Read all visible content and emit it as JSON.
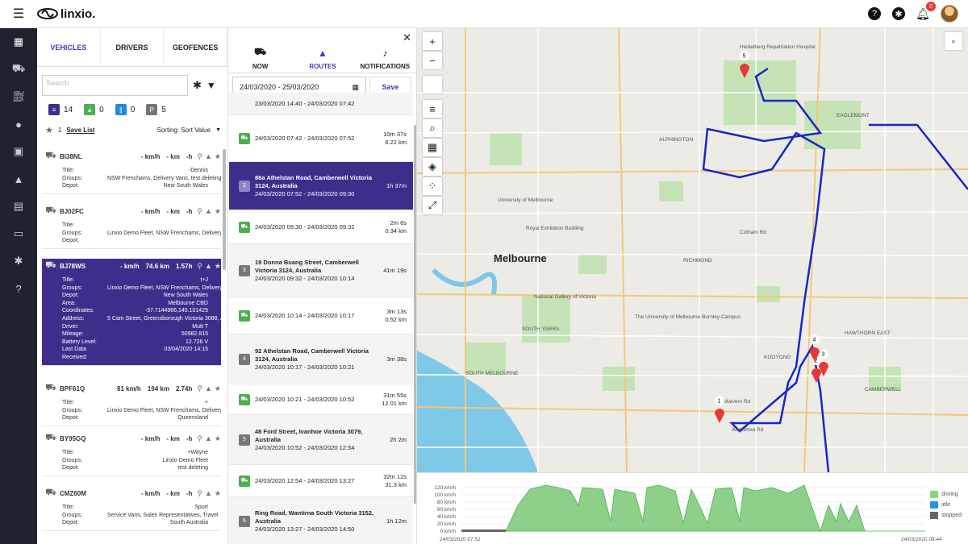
{
  "app": {
    "name": "linxio."
  },
  "topbar": {
    "icons": [
      "help-icon",
      "gear-icon",
      "bell-icon"
    ],
    "notification_count": "0"
  },
  "left_nav": [
    "map-icon",
    "vehicle-icon",
    "fuel-icon",
    "user-icon",
    "image-icon",
    "alert-icon",
    "document-icon",
    "device-icon",
    "settings-icon",
    "help-icon"
  ],
  "panel1": {
    "tabs": [
      "VEHICLES",
      "DRIVERS",
      "GEOFENCES"
    ],
    "search_placeholder": "Search",
    "stats": [
      {
        "label": "14",
        "color": "#3f2d8c",
        "icon": "list-icon"
      },
      {
        "label": "0",
        "color": "#4caf50",
        "icon": "up-icon"
      },
      {
        "label": "0",
        "color": "#1e88e5",
        "icon": "pause-icon"
      },
      {
        "label": "5",
        "color": "#757575",
        "icon": "parked-icon"
      }
    ],
    "saved_count": "1",
    "save_list": "Save List",
    "sorting": "Sorting: Sort Value",
    "vehicles": [
      {
        "reg": "BI38NL",
        "speed": "- km/h",
        "dist": "- km",
        "time": "-h",
        "rows": [
          [
            "Title:",
            "-Dennis"
          ],
          [
            "Groups:",
            "NSW Frenchams, Delivery Vans, test deleting"
          ],
          [
            "Depot:",
            "New South Wales"
          ]
        ]
      },
      {
        "reg": "BJ02FC",
        "speed": "- km/h",
        "dist": "- km",
        "time": "-h",
        "rows": [
          [
            "Title:",
            ""
          ],
          [
            "Groups:",
            "Linxio Demo Fleet, NSW Frenchams, Delivery Vans"
          ],
          [
            "Depot:",
            ""
          ]
        ]
      },
      {
        "reg": "BJ78WS",
        "speed": "- km/h",
        "dist": "74.6 km",
        "time": "1.57h",
        "rows": [
          [
            "Title:",
            "t+J"
          ],
          [
            "Groups:",
            "Linxio Demo Fleet, NSW Frenchams, Delivery Vans"
          ],
          [
            "Depot:",
            "New South Wales"
          ],
          [
            "Area:",
            "Melbourne CBD"
          ],
          [
            "Coordinates:",
            "-37.7144966,145.101425"
          ],
          [
            "Address:",
            "5 Cam Street, Greensborough Victoria 3088, Australia"
          ],
          [
            "Driver:",
            "Mutt T"
          ],
          [
            "Mileage:",
            "50982.815"
          ],
          [
            "Battery Level:",
            "12.726 V"
          ],
          [
            "Last Data Received:",
            "03/04/2020 14:15"
          ]
        ]
      },
      {
        "reg": "BPF61Q",
        "speed": "81 km/h",
        "dist": "194 km",
        "time": "2.74h",
        "rows": [
          [
            "Title:",
            "+"
          ],
          [
            "Groups:",
            "Linxio Demo Fleet, NSW Frenchams, Delivery Vans"
          ],
          [
            "Depot:",
            "Queensland"
          ]
        ]
      },
      {
        "reg": "BY95GQ",
        "speed": "- km/h",
        "dist": "- km",
        "time": "-h",
        "rows": [
          [
            "Title:",
            "+Wayne"
          ],
          [
            "Groups:",
            "Linxio Demo Fleet"
          ],
          [
            "Depot:",
            "test deleting"
          ]
        ]
      },
      {
        "reg": "CMZ60M",
        "speed": "- km/h",
        "dist": "- km",
        "time": "-h",
        "rows": [
          [
            "Title:",
            "Sport"
          ],
          [
            "Groups:",
            "Service Vans, Sales Representatives, Travel"
          ],
          [
            "Depot:",
            "South Australia"
          ]
        ]
      }
    ]
  },
  "panel2": {
    "tabs": [
      {
        "label": "NOW",
        "icon": "car-icon"
      },
      {
        "label": "ROUTES",
        "icon": "navigation-icon"
      },
      {
        "label": "NOTIFICATIONS",
        "icon": "bell-icon"
      }
    ],
    "date_range": "24/03/2020 - 25/03/2020",
    "save": "Save",
    "routes": [
      {
        "kind": "stop",
        "num": "",
        "addr": "",
        "time": "23/03/2020 14:40 - 24/03/2020 07:42",
        "dur": "",
        "dist": ""
      },
      {
        "kind": "drive",
        "num": "",
        "addr": "",
        "time": "24/03/2020 07:42 - 24/03/2020 07:52",
        "dur": "10m 37s",
        "dist": "6.22 km"
      },
      {
        "kind": "stop",
        "num": "2",
        "addr": "86a Athelstan Road, Camberwell Victoria 3124, Australia",
        "time": "24/03/2020 07:52 - 24/03/2020 09:30",
        "dur": "1h 37m",
        "dist": ""
      },
      {
        "kind": "drive",
        "num": "",
        "addr": "",
        "time": "24/03/2020 09:30 - 24/03/2020 09:32",
        "dur": "2m 6s",
        "dist": "0.34 km"
      },
      {
        "kind": "stop",
        "num": "3",
        "addr": "19 Donna Buang Street, Camberwell Victoria 3124, Australia",
        "time": "24/03/2020 09:32 - 24/03/2020 10:14",
        "dur": "41m 19s",
        "dist": ""
      },
      {
        "kind": "drive",
        "num": "",
        "addr": "",
        "time": "24/03/2020 10:14 - 24/03/2020 10:17",
        "dur": "3m 13s",
        "dist": "0.52 km"
      },
      {
        "kind": "stop",
        "num": "4",
        "addr": "92 Athelstan Road, Camberwell Victoria 3124, Australia",
        "time": "24/03/2020 10:17 - 24/03/2020 10:21",
        "dur": "3m 38s",
        "dist": ""
      },
      {
        "kind": "drive",
        "num": "",
        "addr": "",
        "time": "24/03/2020 10:21 - 24/03/2020 10:52",
        "dur": "31m 55s",
        "dist": "12.01 km"
      },
      {
        "kind": "stop",
        "num": "5",
        "addr": "48 Ford Street, Ivanhoe Victoria 3079, Australia",
        "time": "24/03/2020 10:52 - 24/03/2020 12:54",
        "dur": "2h 2m",
        "dist": ""
      },
      {
        "kind": "drive",
        "num": "",
        "addr": "",
        "time": "24/03/2020 12:54 - 24/03/2020 13:27",
        "dur": "32m 12s",
        "dist": "31.3 km"
      },
      {
        "kind": "stop",
        "num": "6",
        "addr": "Ring Road, Wantirna South Victoria 3152, Australia",
        "time": "24/03/2020 13:27 - 24/03/2020 14:50",
        "dur": "1h 12m",
        "dist": ""
      }
    ]
  },
  "map": {
    "city_label": "Melbourne",
    "labels": [
      "Heidelberg Repatriation Hospital",
      "ALPHINGTON",
      "EAGLEMONT",
      "Royal Exhibition Building",
      "University of Melbourne",
      "SOUTH YARRA",
      "RICHMOND",
      "HAWTHORN EAST",
      "KOOYONG",
      "CAMBERWELL",
      "The University of Melbourne Burnley Campus",
      "National Gallery of Victoria",
      "SOUTH MELBOURNE",
      "Cotham Rd",
      "Malvern Rd",
      "Wattletree Rd"
    ],
    "markers": [
      "1",
      "2",
      "3",
      "4",
      "5"
    ],
    "route_color": "#1a25c8"
  },
  "speed_chart": {
    "y_ticks": [
      "0 km/h",
      "20 km/h",
      "40 km/h",
      "60 km/h",
      "80 km/h",
      "100 km/h",
      "120 km/h"
    ],
    "x_start": "24/03/2020 07:52",
    "x_end": "24/03/2020 08:44",
    "legend": [
      {
        "label": "driving",
        "color": "#8ed08a"
      },
      {
        "label": "idle",
        "color": "#1e9be0"
      },
      {
        "label": "stopped",
        "color": "#666666"
      }
    ]
  }
}
